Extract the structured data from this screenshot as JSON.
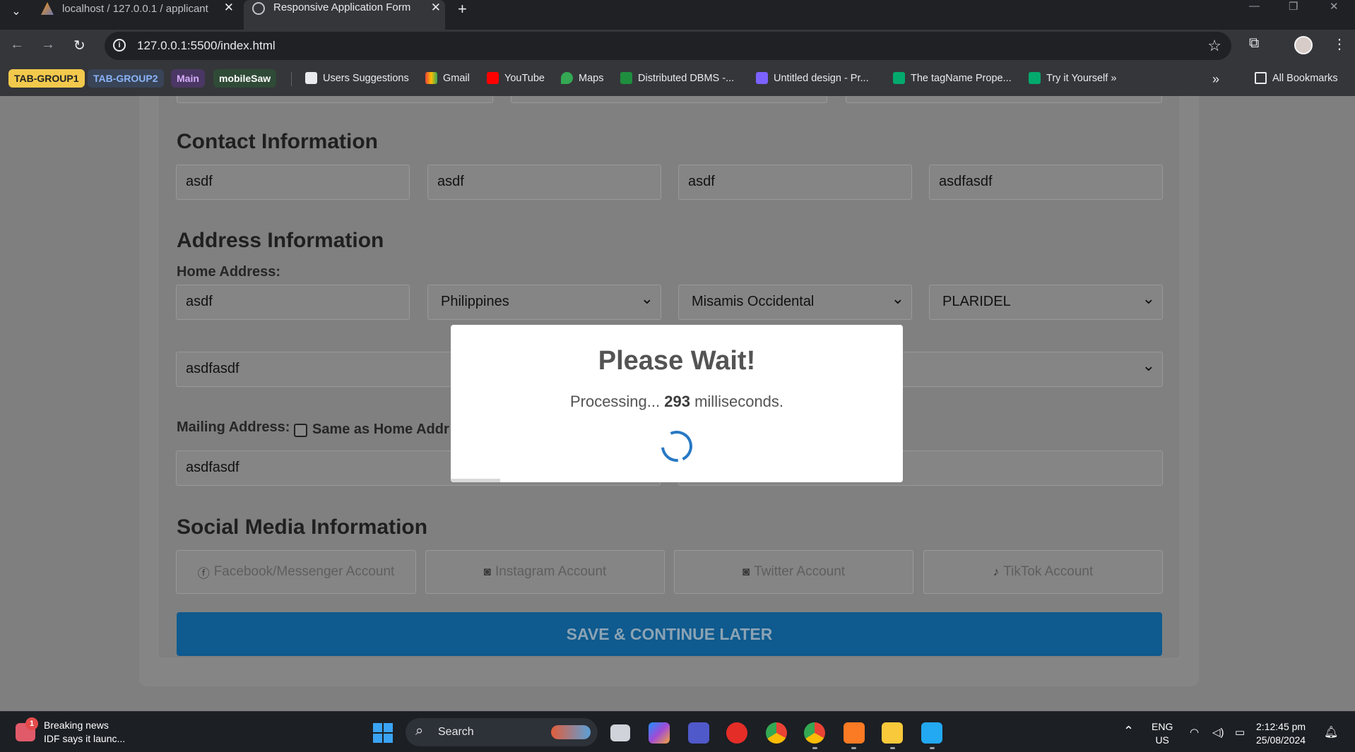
{
  "browser": {
    "tabs": [
      {
        "title": "localhost / 127.0.0.1 / applicant",
        "active": false
      },
      {
        "title": "Responsive Application Form",
        "active": true
      }
    ],
    "url": "127.0.0.1:5500/index.html",
    "tab_groups": [
      {
        "label": "TAB-GROUP1",
        "color": "#f2c94c"
      },
      {
        "label": "TAB-GROUP2",
        "color": "#8ab4f8"
      },
      {
        "label": "Main",
        "color": "#c58af9"
      },
      {
        "label": "mobileSaw",
        "color": "#81c995"
      }
    ],
    "bookmarks": [
      {
        "label": "Users Suggestions",
        "icon": "users-icon"
      },
      {
        "label": "Gmail",
        "icon": "gmail-icon"
      },
      {
        "label": "YouTube",
        "icon": "youtube-icon"
      },
      {
        "label": "Maps",
        "icon": "maps-icon"
      },
      {
        "label": "Distributed DBMS -...",
        "icon": "dbms-icon"
      },
      {
        "label": "Untitled design - Pr...",
        "icon": "canva-icon"
      },
      {
        "label": "The tagName Prope...",
        "icon": "w3schools-icon"
      },
      {
        "label": "Try it Yourself »",
        "icon": "w3schools-icon"
      }
    ],
    "all_bookmarks": "All Bookmarks"
  },
  "form": {
    "contact": {
      "title": "Contact Information",
      "fields": [
        "asdf",
        "asdf",
        "asdf",
        "asdfasdf"
      ]
    },
    "address": {
      "title": "Address Information",
      "home_label": "Home Address:",
      "home_street": "asdf",
      "country": "Philippines",
      "province": "Misamis Occidental",
      "city": "PLARIDEL",
      "home_line2": "asdfasdf",
      "mailing_label": "Mailing Address:",
      "same_as_home": "Same as Home Addr",
      "mailing_line": "asdfasdf"
    },
    "social": {
      "title": "Social Media Information",
      "buttons": [
        {
          "label": "Facebook/Messenger Account",
          "icon": "facebook-icon"
        },
        {
          "label": "Instagram Account",
          "icon": "instagram-icon"
        },
        {
          "label": "Twitter Account",
          "icon": "twitter-icon"
        },
        {
          "label": "TikTok Account",
          "icon": "tiktok-icon"
        }
      ]
    },
    "save_label": "SAVE & CONTINUE LATER"
  },
  "modal": {
    "title": "Please Wait!",
    "text_prefix": "Processing...",
    "ms_value": "293",
    "text_suffix": "milliseconds.",
    "progress_fraction": 0.11
  },
  "taskbar": {
    "news_badge": "1",
    "news_title": "Breaking news",
    "news_sub": "IDF says it launc...",
    "search_placeholder": "Search",
    "lang_top": "ENG",
    "lang_bottom": "US",
    "time": "2:12:45 pm",
    "date": "25/08/2024"
  }
}
